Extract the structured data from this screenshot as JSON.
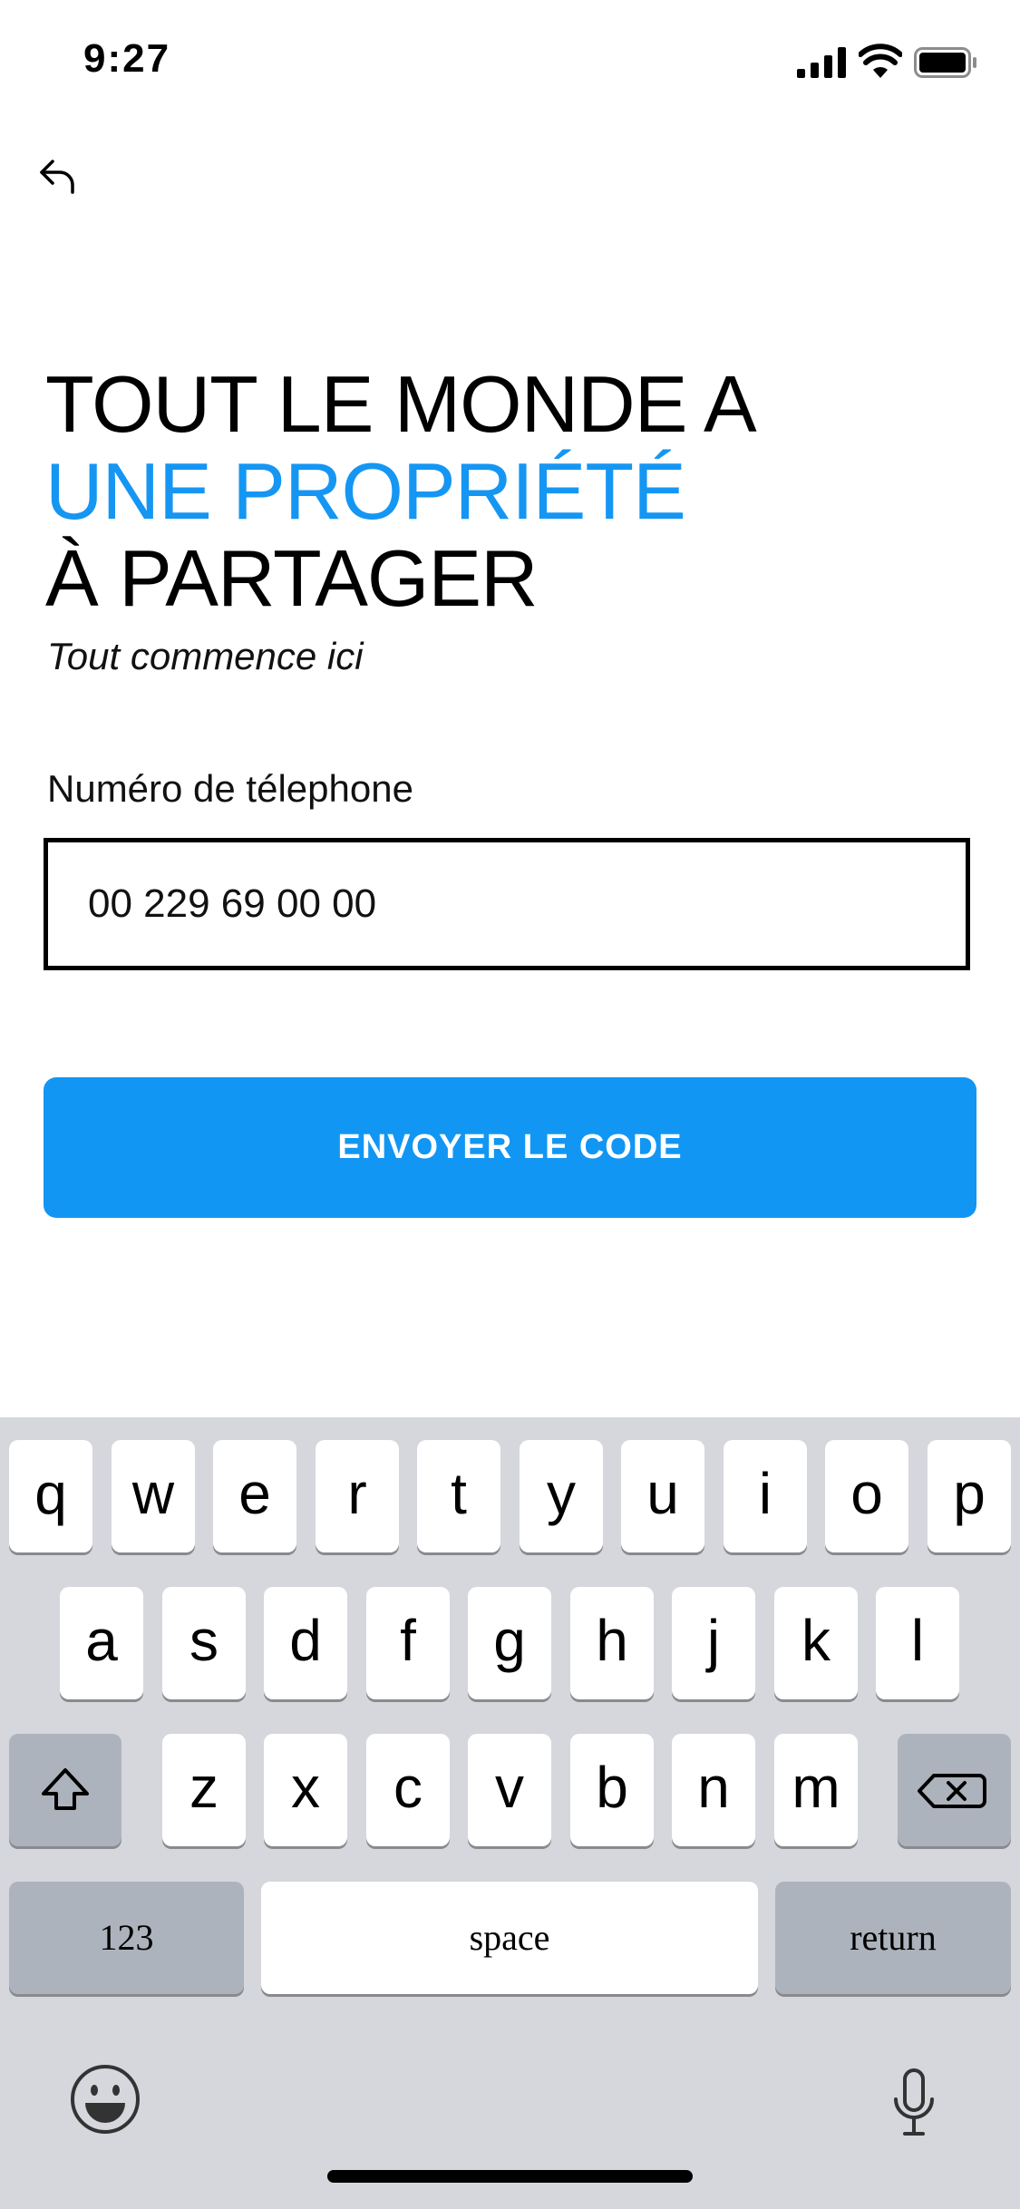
{
  "status_bar": {
    "time": "9:27"
  },
  "headline": {
    "line1": "TOUT LE MONDE A",
    "line2": "UNE PROPRIÉTÉ",
    "line3": "À PARTAGER",
    "subtitle": "Tout commence ici"
  },
  "form": {
    "phone_label": "Numéro de télephone",
    "phone_value": "00 229 69 00 00",
    "submit_label": "ENVOYER LE CODE"
  },
  "keyboard": {
    "row1": [
      "q",
      "w",
      "e",
      "r",
      "t",
      "y",
      "u",
      "i",
      "o",
      "p"
    ],
    "row2": [
      "a",
      "s",
      "d",
      "f",
      "g",
      "h",
      "j",
      "k",
      "l"
    ],
    "row3": [
      "z",
      "x",
      "c",
      "v",
      "b",
      "n",
      "m"
    ],
    "numbers_label": "123",
    "space_label": "space",
    "return_label": "return"
  },
  "colors": {
    "accent": "#1596f3",
    "keyboard_bg": "#d5d7dd"
  },
  "icons": [
    "signal-icon",
    "wifi-icon",
    "battery-icon",
    "back-arrow-icon",
    "shift-icon",
    "backspace-icon",
    "emoji-icon",
    "microphone-icon"
  ]
}
